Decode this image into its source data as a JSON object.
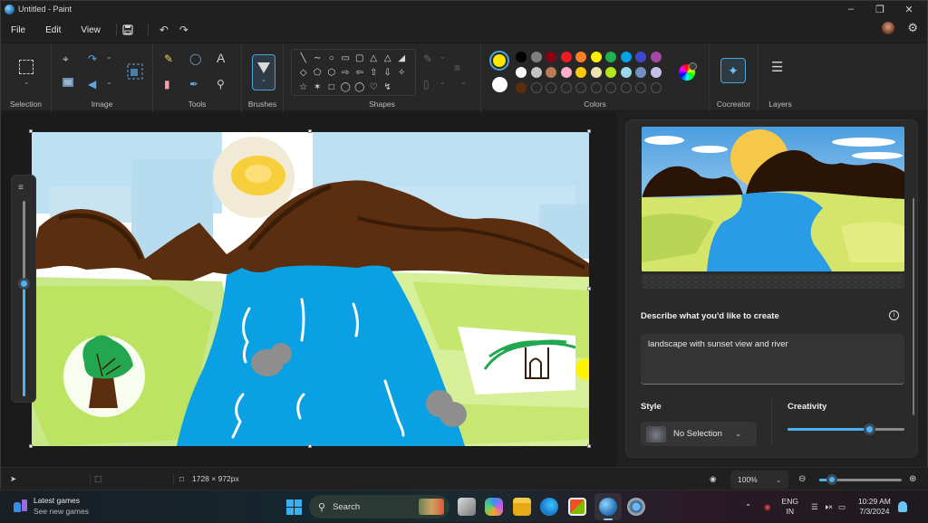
{
  "window": {
    "title": "Untitled - Paint",
    "controls": [
      "minimize",
      "restore",
      "close"
    ]
  },
  "menu": {
    "items": [
      "File",
      "Edit",
      "View"
    ],
    "quick_actions": [
      "save-icon",
      "undo-icon",
      "redo-icon"
    ]
  },
  "ribbon": {
    "groups": {
      "selection": "Selection",
      "image": "Image",
      "tools": "Tools",
      "brushes": "Brushes",
      "shapes": "Shapes",
      "colors": "Colors",
      "cocreator": "Cocreator",
      "layers": "Layers"
    },
    "shapes": [
      "line",
      "curve",
      "oval",
      "rectangle",
      "rounded-rectangle",
      "polygon",
      "triangle",
      "right-triangle",
      "diamond",
      "pentagon",
      "hexagon",
      "arrow-right",
      "arrow-left",
      "arrow-up",
      "arrow-down",
      "star-four",
      "star-five",
      "star-six",
      "callout-rounded-rect",
      "callout-oval",
      "callout-cloud",
      "heart",
      "lightning"
    ],
    "colors": {
      "primary": "#ffe600",
      "secondary": "#ffffff",
      "palette_row1": [
        "#000000",
        "#7f7f7f",
        "#880015",
        "#ed1c24",
        "#ff7f27",
        "#fff200",
        "#22b14c",
        "#00a2e8",
        "#3f48cc",
        "#a349a4"
      ],
      "palette_row2": [
        "#ffffff",
        "#c3c3c3",
        "#b97a57",
        "#ffaec9",
        "#ffc90e",
        "#efe4b0",
        "#b5e61d",
        "#99d9ea",
        "#7092be",
        "#c8bfe7"
      ],
      "palette_row3": [
        "#5a2e0e",
        "",
        "",
        "",
        "",
        "",
        "",
        "",
        "",
        ""
      ]
    }
  },
  "brush_size_slider": {
    "value_fraction": 0.58
  },
  "cocreator": {
    "prompt_label": "Describe what you'd like to create",
    "prompt_value": "landscape with sunset view and river",
    "style_label": "Style",
    "style_value": "No Selection",
    "creativity_label": "Creativity",
    "creativity_fraction": 0.7
  },
  "status": {
    "canvas_size": "1728 × 972px",
    "zoom": "100%",
    "zoom_slider_fraction": 0.15
  },
  "taskbar": {
    "widget_title": "Latest games",
    "widget_subtitle": "See new games",
    "search_label": "Search",
    "lang_top": "ENG",
    "lang_bottom": "IN",
    "time": "10:29 AM",
    "date": "7/3/2024"
  }
}
